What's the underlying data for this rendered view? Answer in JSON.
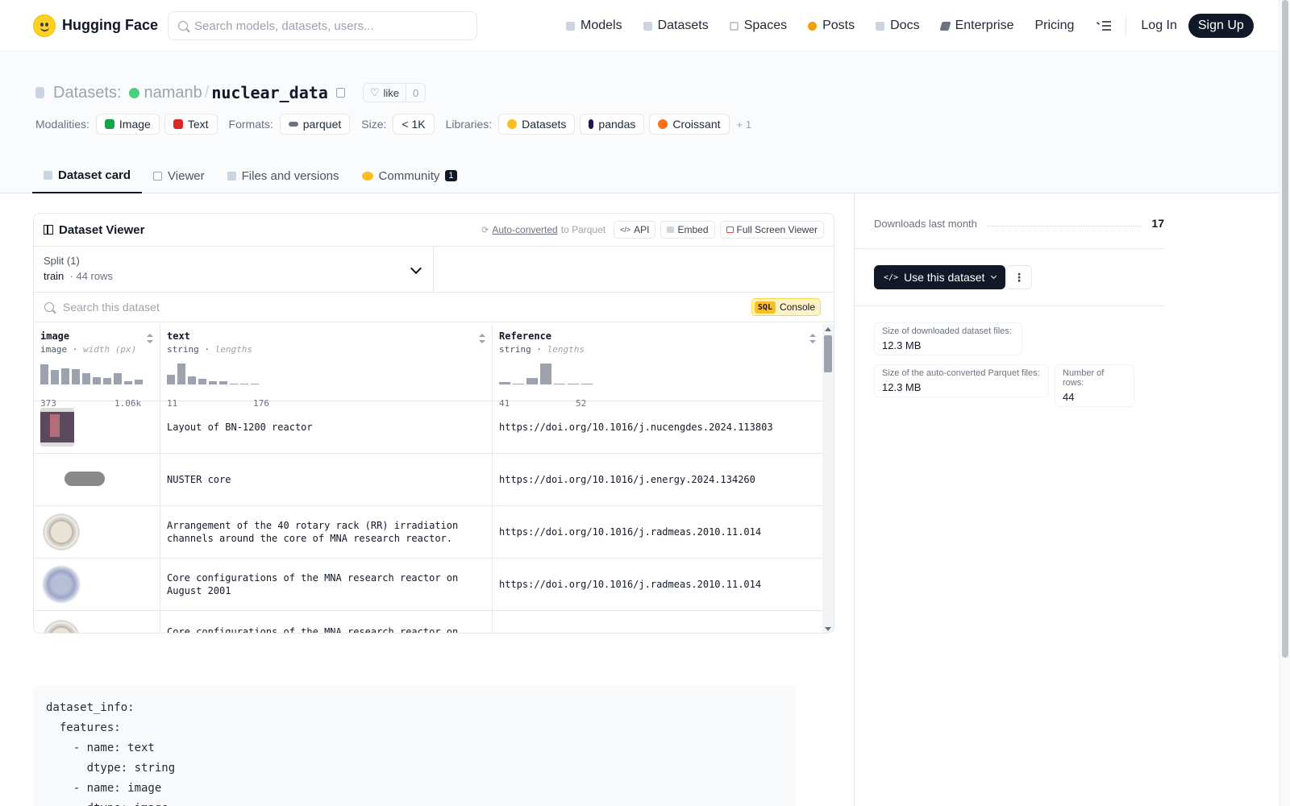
{
  "header": {
    "brand": "Hugging Face",
    "search_placeholder": "Search models, datasets, users...",
    "nav": [
      {
        "label": "Models",
        "icon": "cube-icon"
      },
      {
        "label": "Datasets",
        "icon": "database-icon"
      },
      {
        "label": "Spaces",
        "icon": "grid-icon"
      },
      {
        "label": "Posts",
        "icon": "posts-icon"
      },
      {
        "label": "Docs",
        "icon": "book-icon"
      },
      {
        "label": "Enterprise",
        "icon": "enterprise-icon"
      },
      {
        "label": "Pricing",
        "icon": ""
      }
    ],
    "login": "Log In",
    "signup": "Sign Up"
  },
  "repo": {
    "type_label": "Datasets:",
    "owner": "namanb",
    "name": "nuclear_data",
    "like_label": "like",
    "like_count": "0"
  },
  "tags": {
    "modalities_label": "Modalities:",
    "modalities": [
      "Image",
      "Text"
    ],
    "formats_label": "Formats:",
    "formats": [
      "parquet"
    ],
    "size_label": "Size:",
    "size": "< 1K",
    "libraries_label": "Libraries:",
    "libraries": [
      "Datasets",
      "pandas",
      "Croissant"
    ],
    "more": "+ 1"
  },
  "tabs": [
    {
      "label": "Dataset card",
      "active": true
    },
    {
      "label": "Viewer"
    },
    {
      "label": "Files and versions"
    },
    {
      "label": "Community",
      "badge": "1"
    }
  ],
  "viewer": {
    "title": "Dataset Viewer",
    "auto_converted": "Auto-converted",
    "to_parquet": "to Parquet",
    "api": "API",
    "embed": "Embed",
    "fullscreen": "Full Screen Viewer",
    "split_label": "Split (1)",
    "split_value": "train",
    "split_rows": "44 rows",
    "search_placeholder": "Search this dataset",
    "sql_tag": "SQL",
    "console": "Console",
    "columns": [
      {
        "name": "image",
        "type": "image",
        "stat": "width (px)",
        "min": "373",
        "max": "1.06k",
        "hist": [
          0.95,
          0.7,
          0.75,
          0.72,
          0.55,
          0.35,
          0.32,
          0.55,
          0.15,
          0.22
        ]
      },
      {
        "name": "text",
        "type": "string",
        "stat": "lengths",
        "min": "11",
        "max": "176",
        "hist": [
          0.45,
          1.0,
          0.4,
          0.25,
          0.15,
          0.15,
          0.0,
          0.05,
          0.05
        ]
      },
      {
        "name": "Reference",
        "type": "string",
        "stat": "lengths",
        "min": "41",
        "max": "52",
        "hist": [
          0.1,
          0.05,
          0.3,
          1.0,
          0.0,
          0.05,
          0.04
        ]
      }
    ],
    "rows": [
      {
        "text": "Layout of BN-1200 reactor",
        "ref": "https://doi.org/10.1016/j.nucengdes.2024.113803"
      },
      {
        "text": "NUSTER core",
        "ref": "https://doi.org/10.1016/j.energy.2024.134260"
      },
      {
        "text": "Arrangement of the 40 rotary rack (RR) irradiation channels around the core of MNA research reactor.",
        "ref": "https://doi.org/10.1016/j.radmeas.2010.11.014"
      },
      {
        "text": "Core configurations of the MNA research reactor on August 2001",
        "ref": "https://doi.org/10.1016/j.radmeas.2010.11.014"
      },
      {
        "text": "Core configurations of the MNA research reactor on April",
        "ref": ""
      }
    ]
  },
  "yaml": "dataset_info:\n  features:\n    - name: text\n      dtype: string\n    - name: image\n      dtype: image",
  "sidebar": {
    "downloads_label": "Downloads last month",
    "downloads_value": "17",
    "use_button": "Use this dataset",
    "stats": [
      {
        "label": "Size of downloaded dataset files:",
        "value": "12.3 MB"
      },
      {
        "label": "Size of the auto-converted Parquet files:",
        "value": "12.3 MB"
      },
      {
        "label": "Number of rows:",
        "value": "44"
      }
    ]
  }
}
